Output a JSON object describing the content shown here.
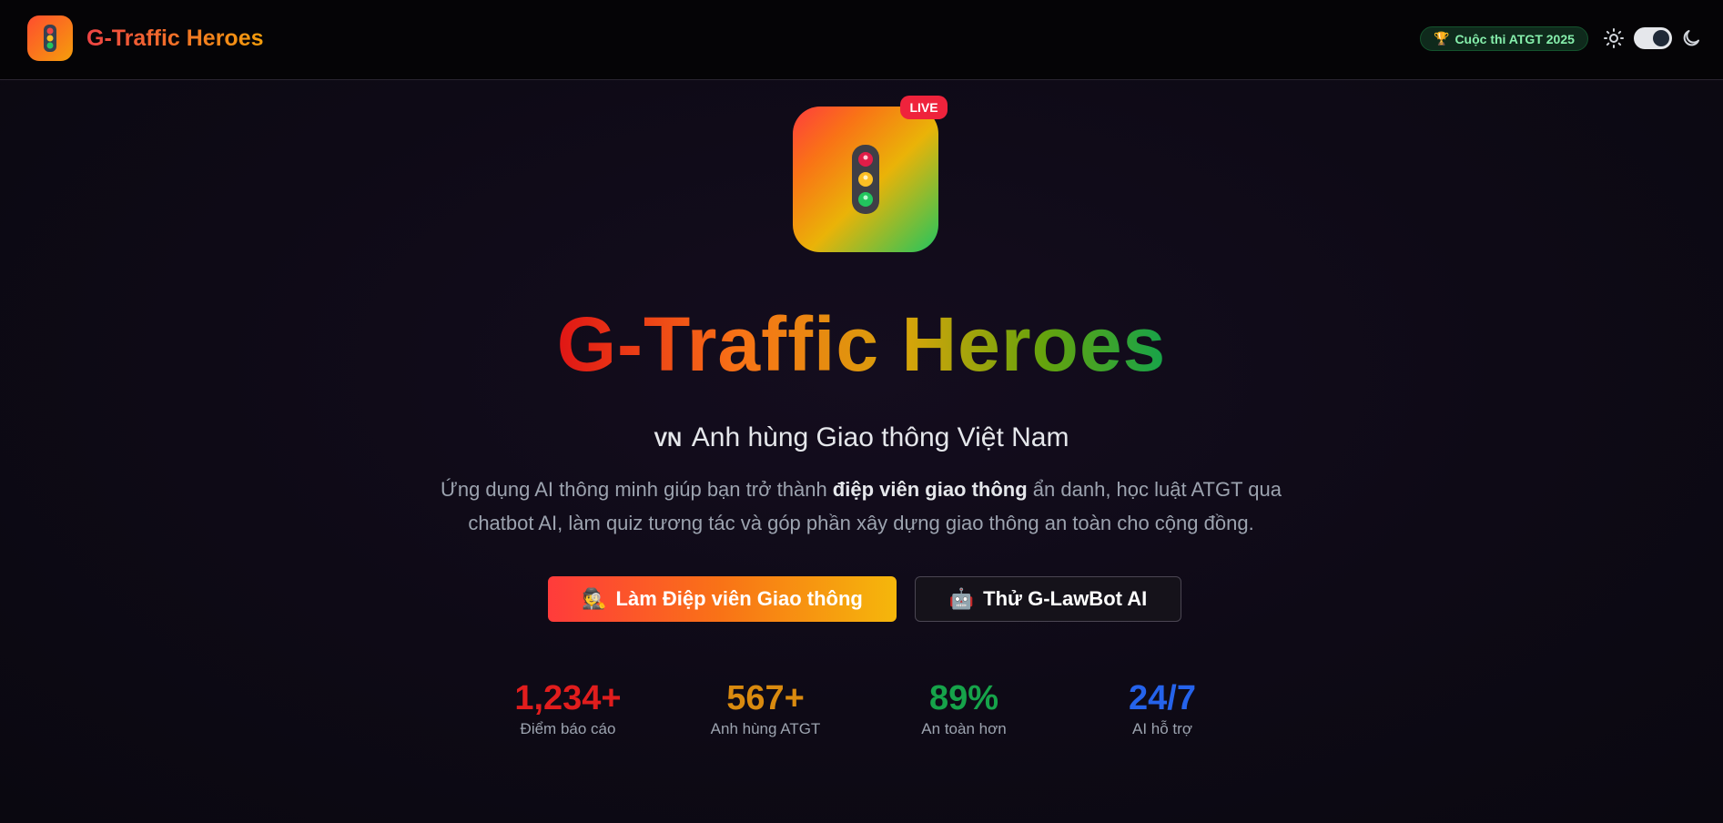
{
  "header": {
    "brand_name": "G-Traffic Heroes",
    "contest_badge_icon": "trophy-icon",
    "contest_badge_label": "Cuộc thi ATGT 2025",
    "theme_toggle_state": "dark"
  },
  "hero": {
    "live_badge": "LIVE",
    "title": "G-Traffic Heroes",
    "subtitle_flag": "VN",
    "subtitle": "Anh hùng Giao thông Việt Nam",
    "description_part1": "Ứng dụng AI thông minh giúp bạn trở thành ",
    "description_bold": "điệp viên giao thông",
    "description_part2": " ẩn danh, học luật ATGT qua chatbot AI, làm quiz tương tác và góp phần xây dựng giao thông an toàn cho cộng đồng."
  },
  "buttons": {
    "primary_icon": "🕵️",
    "primary_label": "Làm Điệp viên Giao thông",
    "secondary_icon": "🤖",
    "secondary_label": "Thử G-LawBot AI"
  },
  "stats": [
    {
      "value": "1,234+",
      "label": "Điểm báo cáo",
      "color": "#e11d1d"
    },
    {
      "value": "567+",
      "label": "Anh hùng ATGT",
      "color": "#d98a0f"
    },
    {
      "value": "89%",
      "label": "An toàn hơn",
      "color": "#16a34a"
    },
    {
      "value": "24/7",
      "label": "AI hỗ trợ",
      "color": "#2563eb"
    }
  ],
  "colors": {
    "accent_red": "#ef4444",
    "accent_orange": "#f59e0b",
    "accent_green": "#22c55e",
    "background": "#0c0812"
  }
}
